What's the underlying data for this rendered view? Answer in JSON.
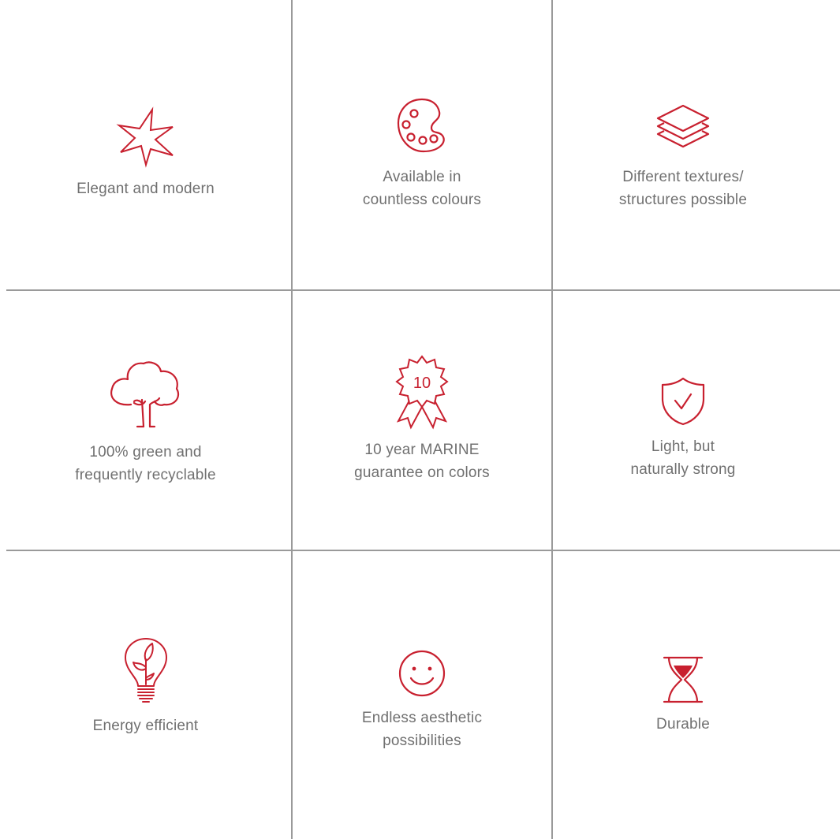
{
  "accent_color": "#c8202f",
  "text_color": "#707070",
  "divider_color": "#9a9a9a",
  "features": [
    {
      "icon": "starburst-icon",
      "lines": [
        "Elegant and modern"
      ]
    },
    {
      "icon": "palette-icon",
      "lines": [
        "Available in",
        "countless colours"
      ]
    },
    {
      "icon": "layers-icon",
      "lines": [
        "Different textures/",
        "structures possible"
      ]
    },
    {
      "icon": "tree-icon",
      "lines": [
        "100% green and",
        "frequently recyclable"
      ]
    },
    {
      "icon": "award-badge-icon",
      "badge_text": "10",
      "lines": [
        "10 year MARINE",
        "guarantee on colors"
      ]
    },
    {
      "icon": "shield-check-icon",
      "lines": [
        "Light, but",
        "naturally strong"
      ]
    },
    {
      "icon": "eco-lightbulb-icon",
      "lines": [
        "Energy efficient"
      ]
    },
    {
      "icon": "smiley-icon",
      "lines": [
        "Endless aesthetic",
        "possibilities"
      ]
    },
    {
      "icon": "hourglass-icon",
      "lines": [
        "Durable"
      ]
    }
  ]
}
